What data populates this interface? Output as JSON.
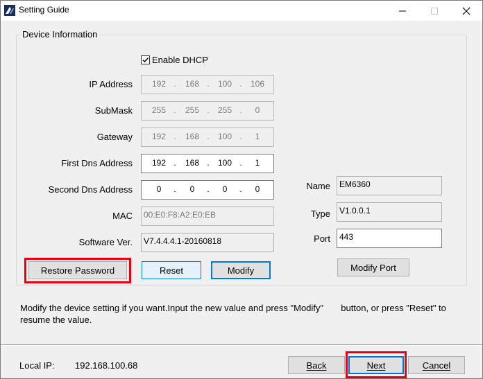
{
  "window": {
    "title": "Setting Guide",
    "controls": {
      "minimize": "—",
      "maximize": "☐",
      "close": "✕"
    }
  },
  "group": {
    "title": "Device Information"
  },
  "dhcp": {
    "label": "Enable DHCP",
    "checked": true
  },
  "labels": {
    "ip": "IP Address",
    "submask": "SubMask",
    "gateway": "Gateway",
    "dns1": "First Dns Address",
    "dns2": "Second Dns Address",
    "mac": "MAC",
    "software": "Software Ver.",
    "name": "Name",
    "type": "Type",
    "port": "Port"
  },
  "fields": {
    "ip": [
      "192",
      "168",
      "100",
      "106"
    ],
    "submask": [
      "255",
      "255",
      "255",
      "0"
    ],
    "gateway": [
      "192",
      "168",
      "100",
      "1"
    ],
    "dns1": [
      "192",
      "168",
      "100",
      "1"
    ],
    "dns2": [
      "0",
      "0",
      "0",
      "0"
    ],
    "mac": "00:E0:F8:A2:E0:EB",
    "software": "V7.4.4.4.1-20160818",
    "name": "EM6360",
    "type": "V1.0.0.1",
    "port": "443"
  },
  "buttons": {
    "restore_password": "Restore Password",
    "reset": "Reset",
    "modify": "Modify",
    "modify_port": "Modify Port",
    "back": "Back",
    "next": "Next",
    "cancel": "Cancel"
  },
  "hint": {
    "line1": "Modify the device setting if you want.Input the new value and press \"Modify\"       button, or press \"Reset\" to",
    "line2": "resume the value."
  },
  "footer": {
    "local_ip_label": "Local IP:",
    "local_ip_value": "192.168.100.68"
  },
  "colors": {
    "highlight": "#e60012",
    "accent": "#0078d7"
  }
}
